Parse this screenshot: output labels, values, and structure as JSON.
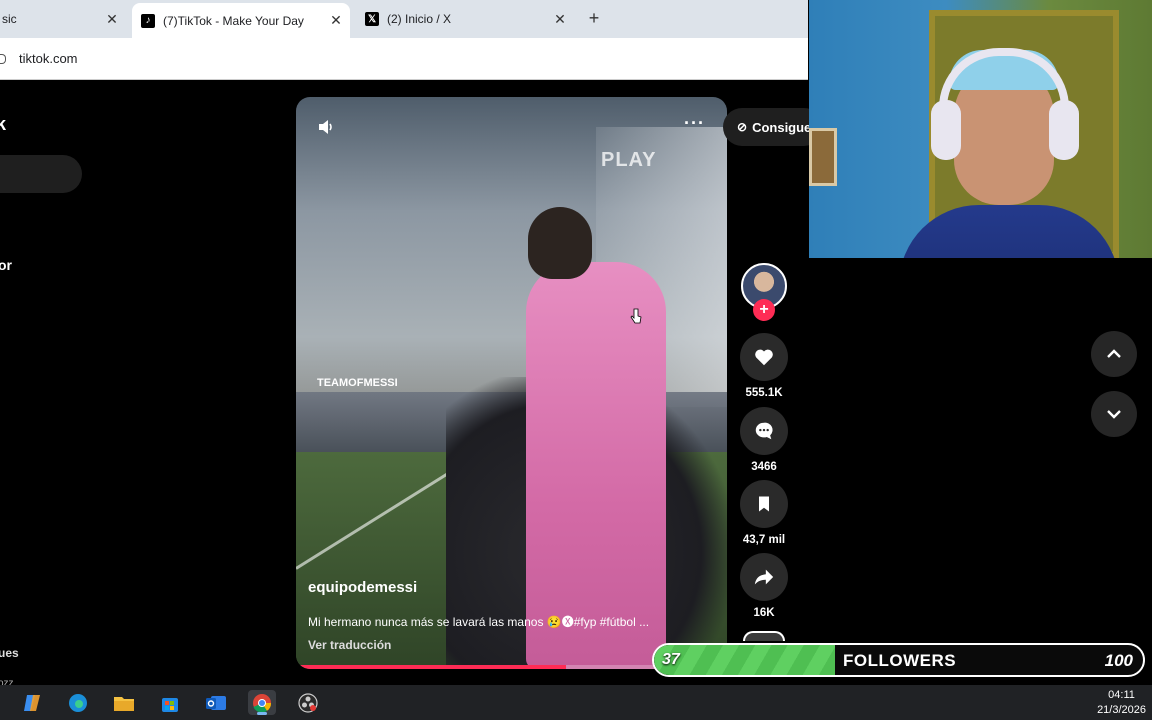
{
  "browser": {
    "tabs": [
      {
        "label": "sic",
        "close": "✕"
      },
      {
        "label": "(7)TikTok - Make Your Day",
        "close": "✕",
        "favicon": "tiktok-icon"
      },
      {
        "label": "(2) Inicio / X",
        "close": "✕",
        "favicon": "x-icon"
      }
    ],
    "new_tab": "+",
    "url": "tiktok.com"
  },
  "sidebar": {
    "logo_fragment": "k",
    "item_fragment": "or",
    "footer_fragment": "ues",
    "footer_fragment_2": "ozz"
  },
  "video": {
    "overlay_play": "PLAY",
    "watermark": "TEAMOFMESSI",
    "username": "equipodemessi",
    "caption": "Mi hermano nunca más se lavará las manos 😢🅧#fyp #fútbol ...",
    "translate": "Ver traducción",
    "more": "···",
    "progress": 0.63
  },
  "coins_button": {
    "label": "Consigue"
  },
  "actions": {
    "likes": "555.1K",
    "comments": "3466",
    "saves": "43,7 mil",
    "shares": "16K",
    "follow": "+"
  },
  "followers_goal": {
    "current": "37",
    "label": "FOLLOWERS",
    "target": "100",
    "fraction": 0.37,
    "accent": "#4fbf52"
  },
  "taskbar": {
    "apps": [
      "copilot-icon",
      "edge-icon",
      "file-explorer-icon",
      "store-icon",
      "outlook-icon",
      "chrome-icon",
      "obs-icon"
    ],
    "time": "04:11",
    "date": "21/3/2026"
  },
  "colors": {
    "tiktok_red": "#fe2c55",
    "tab_bar": "#dde3ea"
  }
}
